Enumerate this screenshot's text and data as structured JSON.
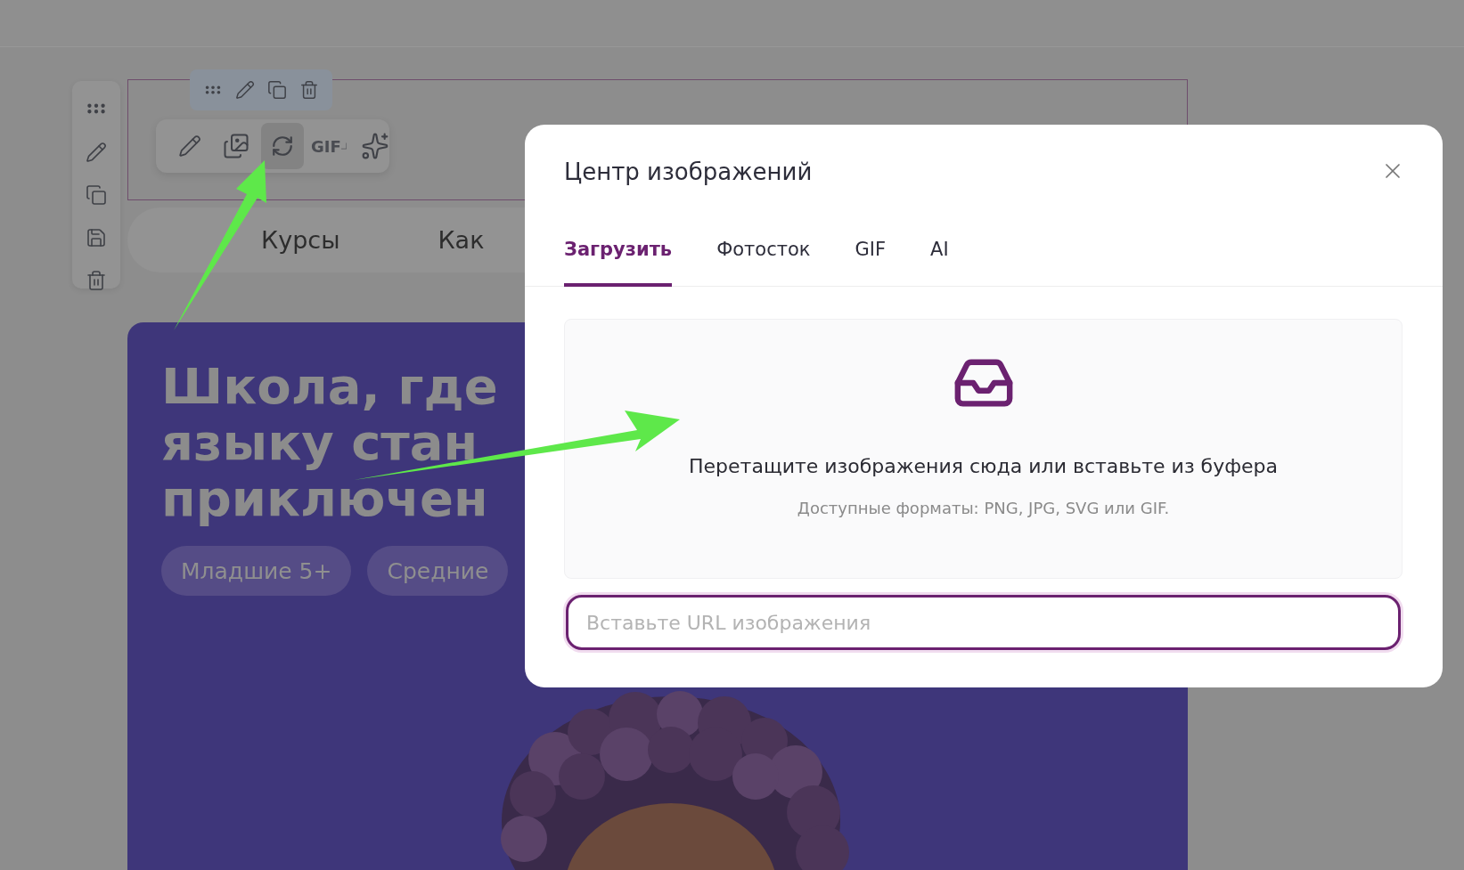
{
  "image_toolbar": {
    "tools": [
      {
        "kind": "edit",
        "selected": false
      },
      {
        "kind": "gallery",
        "selected": false
      },
      {
        "kind": "replace",
        "selected": true
      },
      {
        "kind": "gif",
        "label": "GIF",
        "selected": false
      },
      {
        "kind": "ai",
        "selected": false
      }
    ]
  },
  "nav": {
    "items": [
      "Курсы",
      "Как"
    ]
  },
  "hero": {
    "headline_lines": [
      "Школа, где",
      "языку стан",
      "приключен"
    ],
    "tags": [
      "Младшие 5+",
      "Средние"
    ],
    "photo": {
      "kind": "picture"
    }
  },
  "modal": {
    "title": "Центр изображений",
    "tabs": [
      {
        "label": "Загрузить",
        "selected": true
      },
      {
        "label": "Фотосток",
        "selected": false
      },
      {
        "label": "GIF",
        "selected": false
      },
      {
        "label": "AI",
        "selected": false
      }
    ],
    "dropzone": {
      "title": "Перетащите изображения сюда или вставьте из буфера",
      "hint": "Доступные форматы: PNG, JPG, SVG или GIF."
    },
    "url_field": {
      "placeholder": "Вставьте URL изображения"
    }
  }
}
